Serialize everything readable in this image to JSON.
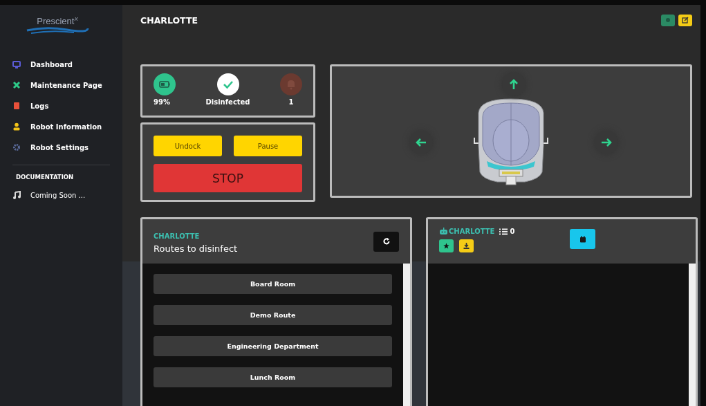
{
  "sidebar": {
    "logo": "Prescient",
    "logo_sup": "X",
    "items": [
      {
        "label": "Dashboard",
        "color": "#5b5bd6"
      },
      {
        "label": "Maintenance Page",
        "color": "#2ecc8a"
      },
      {
        "label": "Logs",
        "color": "#e8503a"
      },
      {
        "label": "Robot Information",
        "color": "#f5c518"
      },
      {
        "label": "Robot Settings",
        "color": "#5a6a9a"
      }
    ],
    "section": "DOCUMENTATION",
    "docs": [
      {
        "label": "Coming Soon ..."
      }
    ]
  },
  "header": {
    "title": "CHARLOTTE"
  },
  "status": [
    {
      "kind": "battery",
      "label": "99%"
    },
    {
      "kind": "check",
      "label": "Disinfected"
    },
    {
      "kind": "alarm",
      "label": "1"
    }
  ],
  "controls": {
    "buttons": [
      "Undock",
      "Pause"
    ],
    "stop": "STOP"
  },
  "routes": {
    "robot": "CHARLOTTE",
    "title": "Routes to disinfect",
    "items": [
      "Board Room",
      "Demo Route",
      "Engineering Department",
      "Lunch Room"
    ]
  },
  "schedule": {
    "robot": "CHARLOTTE",
    "count": "0"
  }
}
